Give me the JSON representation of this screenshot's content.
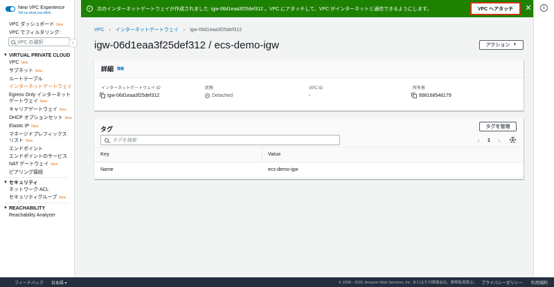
{
  "flash": {
    "message": "次のインターネットゲートウェイが作成されました: igw-06d1eaa3f25def312 。VPC にアタッチして、VPC がインターネットと通信できるようにします。",
    "attach_button": "VPC へアタッチ",
    "close": "✕",
    "color": "#1d8102"
  },
  "sidebar": {
    "title": "New VPC Experience",
    "subtitle": "Tell us what you think",
    "dashboard": "VPC ダッシュボード",
    "filter_label": "VPC でフィルタリング:",
    "filter_placeholder": "VPC の選択",
    "new_badge": "New",
    "collapse": "‹",
    "sections": [
      {
        "title": "VIRTUAL PRIVATE CLOUD",
        "items": [
          {
            "label": "VPC",
            "new": true
          },
          {
            "label": "サブネット",
            "new": true
          },
          {
            "label": "ルートテーブル",
            "new": false
          },
          {
            "label": "インターネットゲートウェイ",
            "new": true,
            "active": true
          },
          {
            "label": "Egress Only インターネットゲートウェイ",
            "new": true
          },
          {
            "label": "キャリアゲートウェイ",
            "new": true
          },
          {
            "label": "DHCP オプションセット",
            "new": true
          },
          {
            "label": "Elastic IP",
            "new": true
          },
          {
            "label": "マネージドプレフィックスリスト",
            "new": true
          },
          {
            "label": "エンドポイント",
            "new": false
          },
          {
            "label": "エンドポイントのサービス",
            "new": false
          },
          {
            "label": "NAT ゲートウェイ",
            "new": true
          },
          {
            "label": "ピアリング接続",
            "new": false
          }
        ]
      },
      {
        "title": "セキュリティ",
        "items": [
          {
            "label": "ネットワーク ACL",
            "new": false
          },
          {
            "label": "セキュリティグループ",
            "new": true
          }
        ]
      },
      {
        "title": "REACHABILITY",
        "items": [
          {
            "label": "Reachability Analyzer",
            "new": false
          }
        ]
      }
    ]
  },
  "rightbar": {
    "info": "i"
  },
  "breadcrumb": {
    "items": [
      "VPC",
      "インターネットゲートウェイ",
      "igw-06d1eaa3f25def312"
    ],
    "separator": "›"
  },
  "page": {
    "title": "igw-06d1eaa3f25def312 / ecs-demo-igw",
    "action_button": "アクション"
  },
  "details": {
    "title": "詳細",
    "info": "情報",
    "fields": [
      {
        "label": "インターネットゲートウェイ ID",
        "value": "igw-06d1eaa3f25def312"
      },
      {
        "label": "状態",
        "value": "Detached"
      },
      {
        "label": "VPC ID",
        "value": "-"
      },
      {
        "label": "所有者",
        "value": "898168548179"
      }
    ]
  },
  "tags": {
    "title": "タグ",
    "manage_button": "タグを管理",
    "search_placeholder": "タグを検索",
    "page": "1",
    "prev": "‹",
    "next": "›",
    "columns": [
      "Key",
      "Value"
    ],
    "rows": [
      {
        "key": "Name",
        "value": "ecs-demo-igw"
      }
    ]
  },
  "footer": {
    "feedback": "フィードバック",
    "language": "日本語 ▾",
    "copyright": "© 2008 - 2020, Amazon Web Services, Inc. またはその関連会社。無断転用禁止。",
    "privacy": "プライバシーポリシー",
    "terms": "利用規約"
  }
}
